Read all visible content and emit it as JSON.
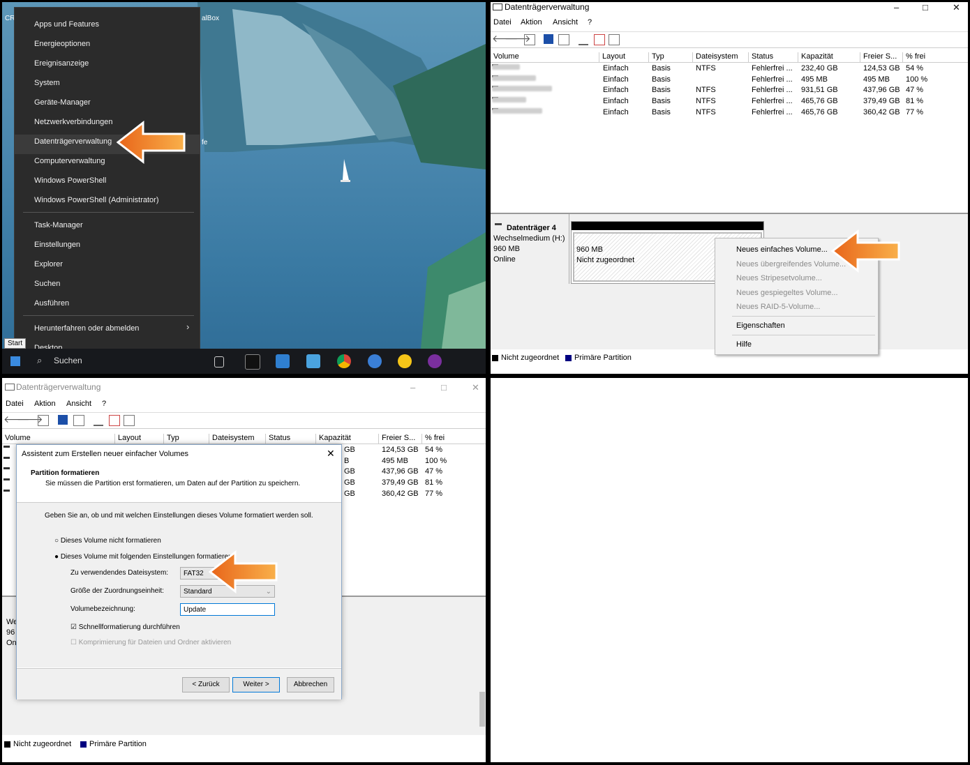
{
  "desktop": {
    "partial_label_left": "CR",
    "partial_label_right": "alBox",
    "partial_label_mid": "fe",
    "start_tooltip": "Start",
    "search_text": "Suchen",
    "winx_menu": {
      "items": [
        "Apps und Features",
        "Energieoptionen",
        "Ereignisanzeige",
        "System",
        "Geräte-Manager",
        "Netzwerkverbindungen",
        "Datenträgerverwaltung",
        "Computerverwaltung",
        "Windows PowerShell",
        "Windows PowerShell (Administrator)"
      ],
      "items2": [
        "Task-Manager",
        "Einstellungen",
        "Explorer",
        "Suchen",
        "Ausführen"
      ],
      "items3": [
        "Herunterfahren oder abmelden",
        "Desktop"
      ],
      "highlighted": "Datenträgerverwaltung"
    }
  },
  "window": {
    "title": "Datenträgerverwaltung",
    "menu": [
      "Datei",
      "Aktion",
      "Ansicht",
      "?"
    ],
    "columns": [
      "Volume",
      "Layout",
      "Typ",
      "Dateisystem",
      "Status",
      "Kapazität",
      "Freier S...",
      "% frei"
    ],
    "rows": [
      {
        "layout": "Einfach",
        "typ": "Basis",
        "fs": "NTFS",
        "status": "Fehlerfrei ...",
        "cap": "232,40 GB",
        "free": "124,53 GB",
        "pct": "54 %"
      },
      {
        "layout": "Einfach",
        "typ": "Basis",
        "fs": "",
        "status": "Fehlerfrei ...",
        "cap": "495 MB",
        "free": "495 MB",
        "pct": "100 %"
      },
      {
        "layout": "Einfach",
        "typ": "Basis",
        "fs": "NTFS",
        "status": "Fehlerfrei ...",
        "cap": "931,51 GB",
        "free": "437,96 GB",
        "pct": "47 %"
      },
      {
        "layout": "Einfach",
        "typ": "Basis",
        "fs": "NTFS",
        "status": "Fehlerfrei ...",
        "cap": "465,76 GB",
        "free": "379,49 GB",
        "pct": "81 %"
      },
      {
        "layout": "Einfach",
        "typ": "Basis",
        "fs": "NTFS",
        "status": "Fehlerfrei ...",
        "cap": "465,76 GB",
        "free": "360,42 GB",
        "pct": "77 %"
      }
    ],
    "disk": {
      "name": "Datenträger 4",
      "type": "Wechselmedium (H:)",
      "size": "960 MB",
      "state": "Online",
      "part_size": "960 MB",
      "part_state": "Nicht zugeordnet"
    },
    "legend": [
      "Nicht zugeordnet",
      "Primäre Partition"
    ],
    "context_menu": {
      "items": [
        "Neues einfaches Volume...",
        "Neues übergreifendes Volume...",
        "Neues Stripesetvolume...",
        "Neues gespiegeltes Volume...",
        "Neues RAID-5-Volume..."
      ],
      "items2": [
        "Eigenschaften"
      ],
      "items3": [
        "Hilfe"
      ]
    }
  },
  "wizard": {
    "title": "Assistent zum Erstellen neuer einfacher Volumes",
    "heading": "Partition formatieren",
    "subheading": "Sie müssen die Partition erst formatieren, um Daten auf der Partition zu speichern.",
    "prompt": "Geben Sie an, ob und mit welchen Einstellungen dieses Volume formatiert werden soll.",
    "opt_no_format": "Dieses Volume nicht formatieren",
    "opt_format": "Dieses Volume mit folgenden Einstellungen formatieren:",
    "fs_label": "Zu verwendendes Dateisystem:",
    "fs_value": "FAT32",
    "alloc_label": "Größe der Zuordnungseinheit:",
    "alloc_value": "Standard",
    "vol_label": "Volumebezeichnung:",
    "vol_value": "Update",
    "quick_format": "Schnellformatierung durchführen",
    "compression": "Komprimierung für Dateien und Ordner aktivieren",
    "btn_back": "< Zurück",
    "btn_next": "Weiter >",
    "btn_cancel": "Abbrechen",
    "bg_partial": [
      "We",
      "96",
      "On"
    ],
    "bg_partial_col": [
      "GB",
      "B",
      "GB",
      "GB",
      "GB"
    ]
  },
  "colors": {
    "arrow": "#f08a1c",
    "menu_bg": "#2b2b2b",
    "accent": "#0078d7",
    "primary_partition": "#000080"
  }
}
